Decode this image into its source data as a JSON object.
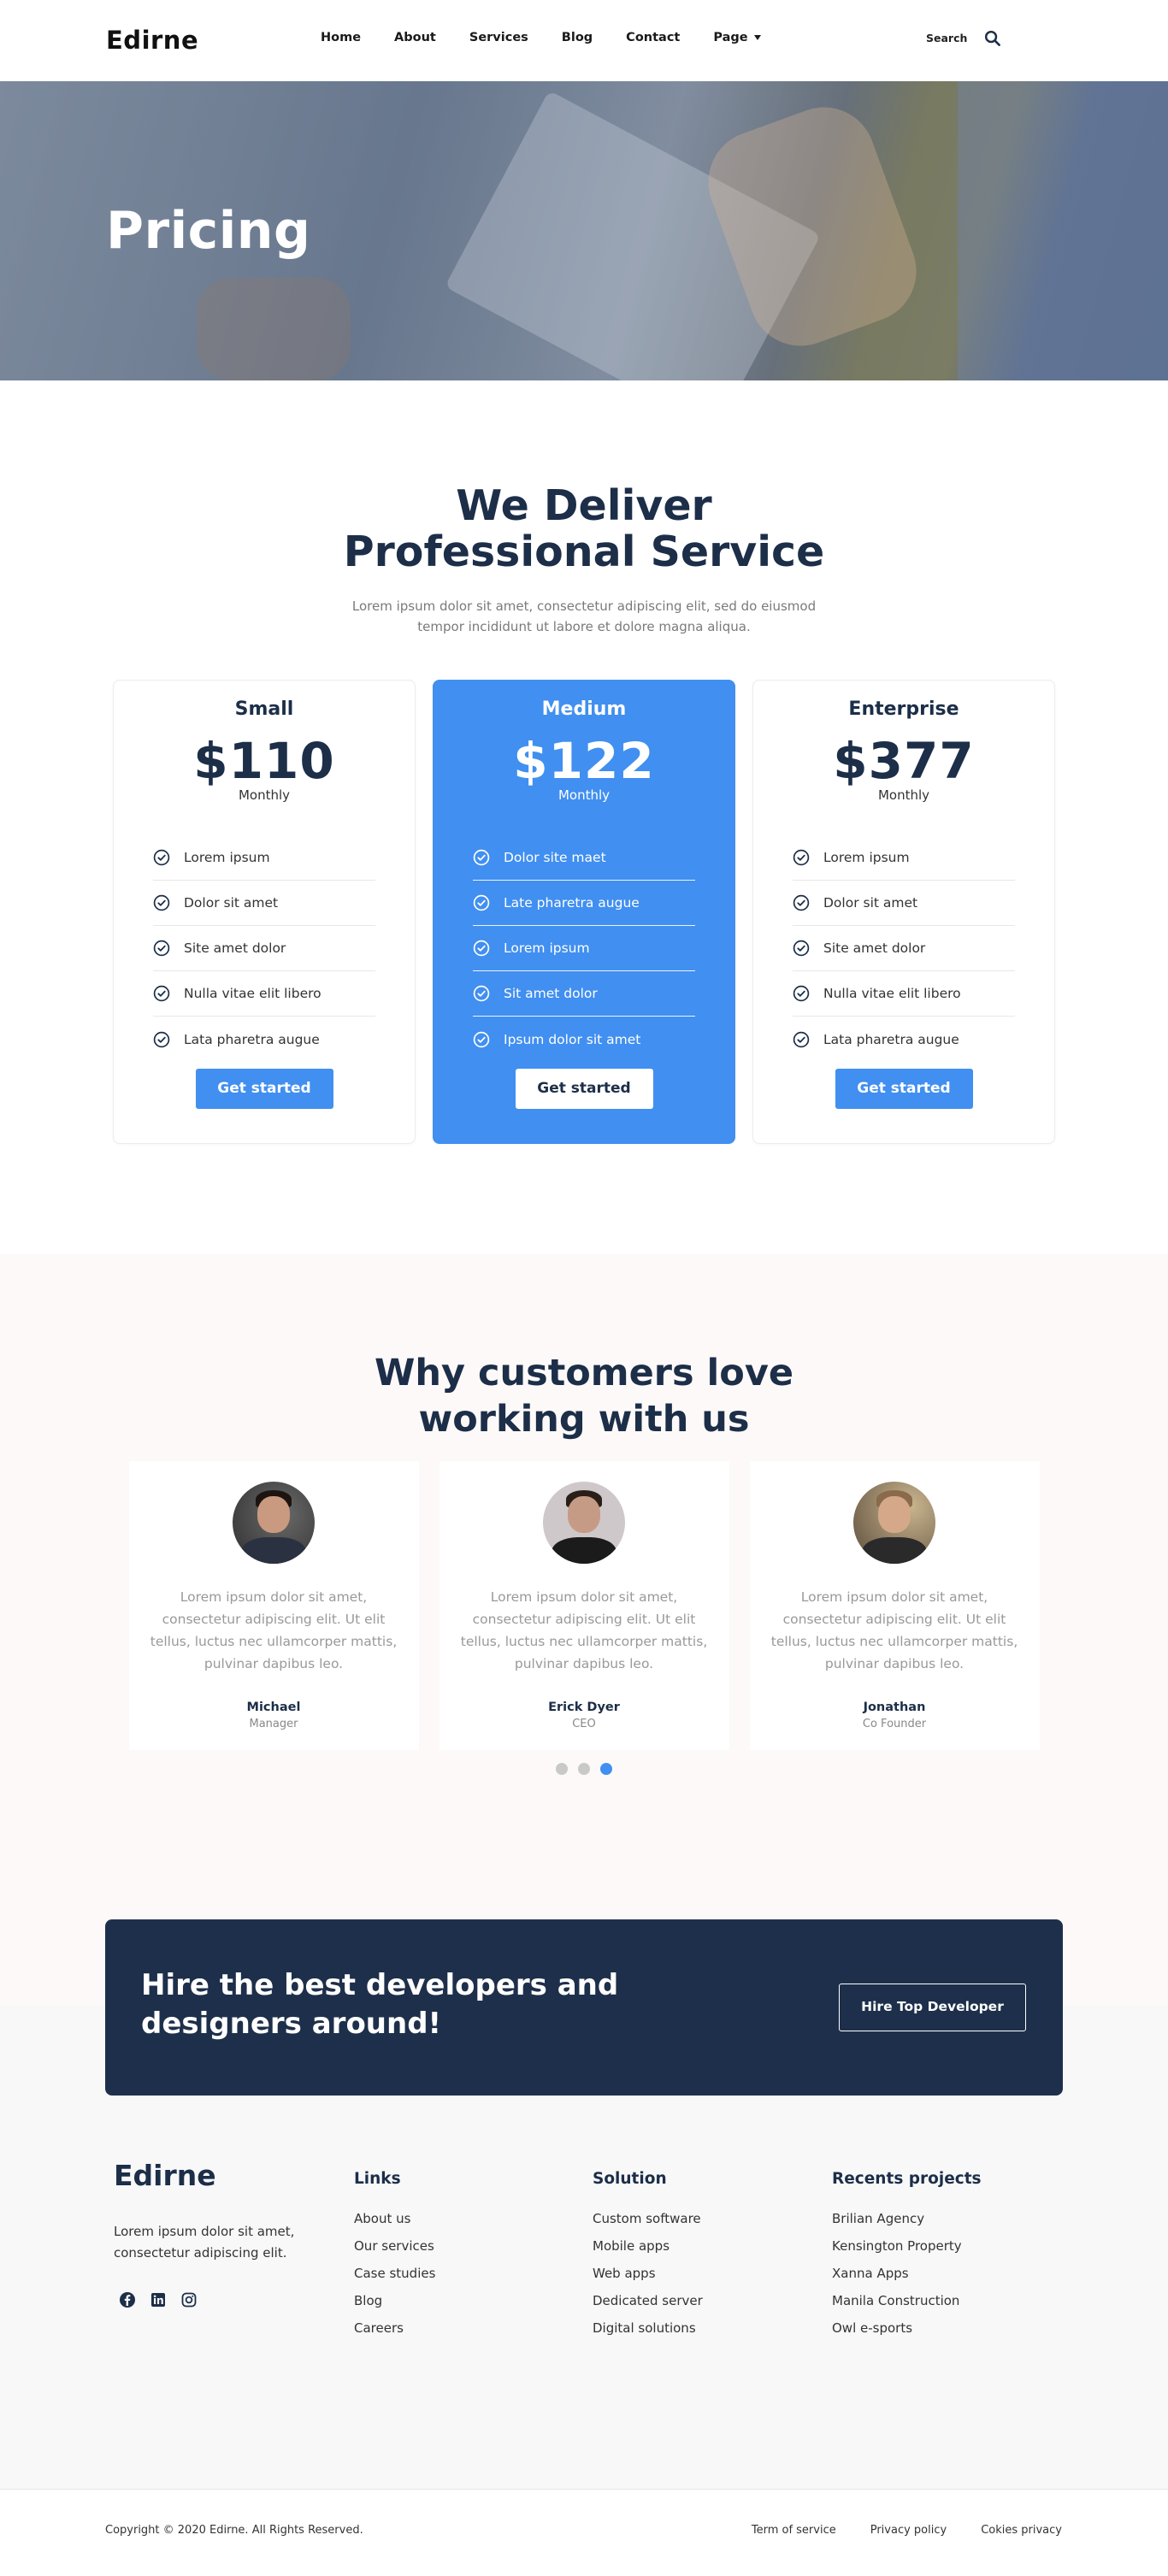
{
  "header": {
    "logo": "Edirne",
    "nav": [
      {
        "label": "Home"
      },
      {
        "label": "About"
      },
      {
        "label": "Services"
      },
      {
        "label": "Blog"
      },
      {
        "label": "Contact"
      },
      {
        "label": "Page",
        "has_dropdown": true
      }
    ],
    "search_label": "Search"
  },
  "hero": {
    "title": "Pricing"
  },
  "pricing": {
    "title": "We Deliver Professional Service",
    "subtitle": "Lorem ipsum dolor sit amet, consectetur adipiscing elit, sed do eiusmod tempor incididunt ut labore et dolore magna aliqua.",
    "plans": [
      {
        "name": "Small",
        "price": "$110",
        "period": "Monthly",
        "featured": false,
        "features": [
          "Lorem ipsum",
          "Dolor sit amet",
          "Site amet dolor",
          "Nulla vitae elit libero",
          "Lata pharetra augue"
        ],
        "button": "Get started"
      },
      {
        "name": "Medium",
        "price": "$122",
        "period": "Monthly",
        "featured": true,
        "features": [
          "Dolor site maet",
          "Late pharetra augue",
          "Lorem ipsum",
          "Sit amet dolor",
          "Ipsum dolor sit amet"
        ],
        "button": "Get started"
      },
      {
        "name": "Enterprise",
        "price": "$377",
        "period": "Monthly",
        "featured": false,
        "features": [
          "Lorem ipsum",
          "Dolor sit amet",
          "Site amet dolor",
          "Nulla vitae elit libero",
          "Lata pharetra augue"
        ],
        "button": "Get started"
      }
    ],
    "colors": {
      "accent": "#418ff0",
      "heading": "#1c2e48"
    }
  },
  "testimonials": {
    "title": "Why customers love working with us",
    "items": [
      {
        "quote": "Lorem ipsum dolor sit amet, consectetur adipiscing elit. Ut elit tellus, luctus nec ullamcorper mattis, pulvinar dapibus leo.",
        "name": "Michael",
        "role": "Manager"
      },
      {
        "quote": "Lorem ipsum dolor sit amet, consectetur adipiscing elit. Ut elit tellus, luctus nec ullamcorper mattis, pulvinar dapibus leo.",
        "name": "Erick Dyer",
        "role": "CEO"
      },
      {
        "quote": "Lorem ipsum dolor sit amet, consectetur adipiscing elit. Ut elit tellus, luctus nec ullamcorper mattis, pulvinar dapibus leo.",
        "name": "Jonathan",
        "role": "Co Founder"
      }
    ],
    "carousel": {
      "total": 3,
      "active_index": 2
    }
  },
  "cta": {
    "text": "Hire the best developers and designers around!",
    "button": "Hire Top Developer",
    "bg_color": "#1d2f4a"
  },
  "footer": {
    "logo": "Edirne",
    "about": "Lorem ipsum dolor sit amet, consectetur adipiscing elit.",
    "socials": [
      "facebook-icon",
      "linkedin-icon",
      "instagram-icon"
    ],
    "columns": [
      {
        "title": "Links",
        "items": [
          "About us",
          "Our services",
          "Case studies",
          "Blog",
          "Careers"
        ]
      },
      {
        "title": "Solution",
        "items": [
          "Custom software",
          "Mobile apps",
          "Web apps",
          "Dedicated server",
          "Digital solutions"
        ]
      },
      {
        "title": "Recents projects",
        "items": [
          "Brilian Agency",
          "Kensington Property",
          "Xanna Apps",
          "Manila Construction",
          "Owl e-sports"
        ]
      }
    ],
    "copyright": "Copyright © 2020 Edirne. All Rights Reserved.",
    "legal_links": [
      "Term of service",
      "Privacy policy",
      "Cokies privacy"
    ]
  }
}
